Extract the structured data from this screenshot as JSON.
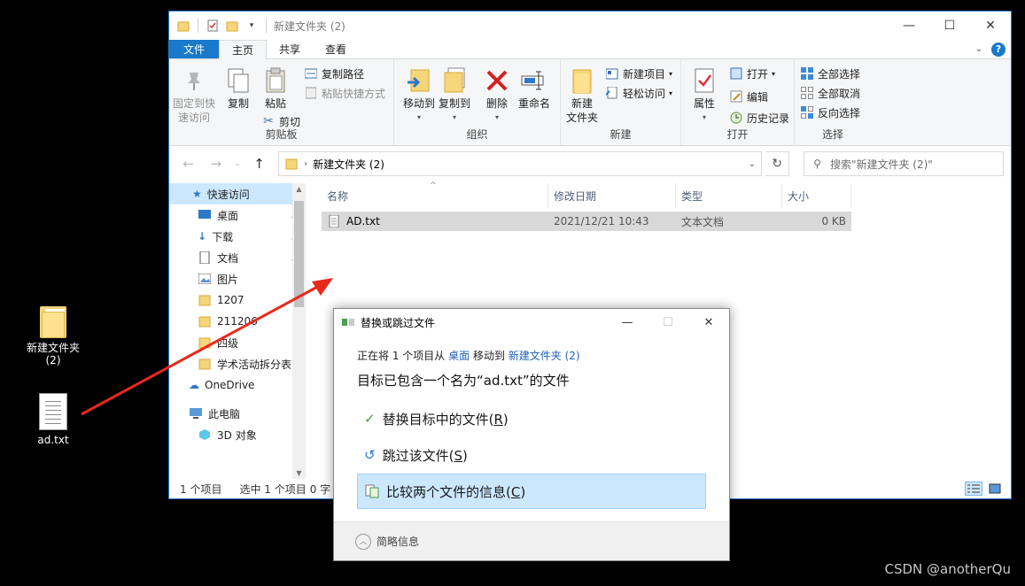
{
  "desktop": {
    "folder_label": "新建文件夹\n(2)",
    "folder_label_line1": "新建文件夹",
    "folder_label_line2": "(2)",
    "txt_label": "ad.txt"
  },
  "window": {
    "title": "新建文件夹 (2)",
    "tabs": [
      "文件",
      "主页",
      "共享",
      "查看"
    ]
  },
  "ribbon": {
    "clipboard": {
      "label": "剪贴板",
      "pin_quick_line1": "固定到快",
      "pin_quick_line2": "速访问",
      "copy": "复制",
      "paste": "粘贴",
      "copy_path": "复制路径",
      "paste_shortcut": "粘贴快捷方式",
      "cut": "剪切"
    },
    "organize": {
      "label": "组织",
      "move_to": "移动到",
      "copy_to": "复制到",
      "delete": "删除",
      "rename": "重命名"
    },
    "new": {
      "label": "新建",
      "new_folder_line1": "新建",
      "new_folder_line2": "文件夹",
      "new_item": "新建项目",
      "easy_access": "轻松访问"
    },
    "open": {
      "label": "打开",
      "properties": "属性",
      "open": "打开",
      "edit": "编辑",
      "history": "历史记录"
    },
    "select": {
      "label": "选择",
      "select_all": "全部选择",
      "select_none": "全部取消",
      "invert": "反向选择"
    }
  },
  "address": {
    "path": "新建文件夹 (2)",
    "search_placeholder": "搜索\"新建文件夹 (2)\""
  },
  "nav": {
    "items": [
      {
        "label": "快速访问"
      },
      {
        "label": "桌面"
      },
      {
        "label": "下载"
      },
      {
        "label": "文档"
      },
      {
        "label": "图片"
      },
      {
        "label": "1207"
      },
      {
        "label": "211206"
      },
      {
        "label": "四级"
      },
      {
        "label": "学术活动拆分表"
      },
      {
        "label": "OneDrive"
      },
      {
        "label": "此电脑"
      },
      {
        "label": "3D 对象"
      }
    ]
  },
  "files": {
    "columns": [
      "名称",
      "修改日期",
      "类型",
      "大小"
    ],
    "rows": [
      {
        "name": "AD.txt",
        "date": "2021/12/21 10:43",
        "type": "文本文档",
        "size": "0 KB"
      }
    ]
  },
  "status": {
    "count": "1 个项目",
    "selected": "选中 1 个项目",
    "size": "0 字"
  },
  "dialog": {
    "title": "替换或跳过文件",
    "line_prefix": "正在将 1 个项目从",
    "src": "桌面",
    "line_mid": "移动到",
    "dst": "新建文件夹 (2)",
    "heading": "目标已包含一个名为“ad.txt”的文件",
    "opt_replace": "替换目标中的文件(",
    "opt_replace_key": "R",
    "opt_skip": "跳过该文件(",
    "opt_skip_key": "S",
    "opt_compare": "比较两个文件的信息(",
    "opt_compare_key": "C",
    "close_paren": ")",
    "details": "简略信息"
  },
  "watermark": "CSDN @anotherQu",
  "colors": {
    "accent": "#1979ca",
    "selection": "#cce8ff",
    "arrow": "#e8291c"
  }
}
